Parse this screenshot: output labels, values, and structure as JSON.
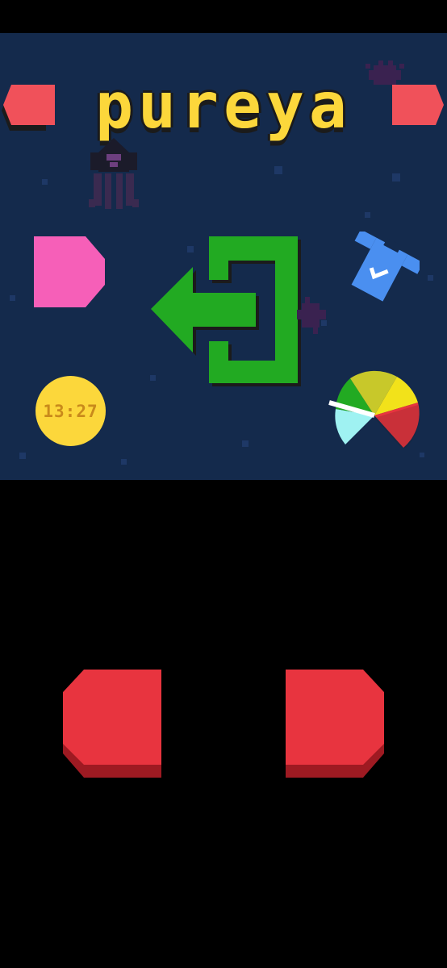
{
  "game": {
    "title": "pureya",
    "clock_time": "13:27"
  },
  "colors": {
    "background": "#142a4c",
    "title_yellow": "#fcd73b",
    "banner_red": "#f0515a",
    "exit_green": "#22aa22",
    "pink_tab": "#f65fb8",
    "shirt_blue": "#4a8ff0",
    "control_red": "#e8343f",
    "control_shadow": "#9e1a22"
  },
  "icons": {
    "exit": "exit-door-arrow-icon",
    "shirt": "shirt-icon",
    "gauge": "speedometer-gauge-icon",
    "tab": "pink-tab-icon",
    "clock": "clock-icon",
    "squid": "squid-sprite",
    "urchin": "sea-urchin-sprite"
  }
}
